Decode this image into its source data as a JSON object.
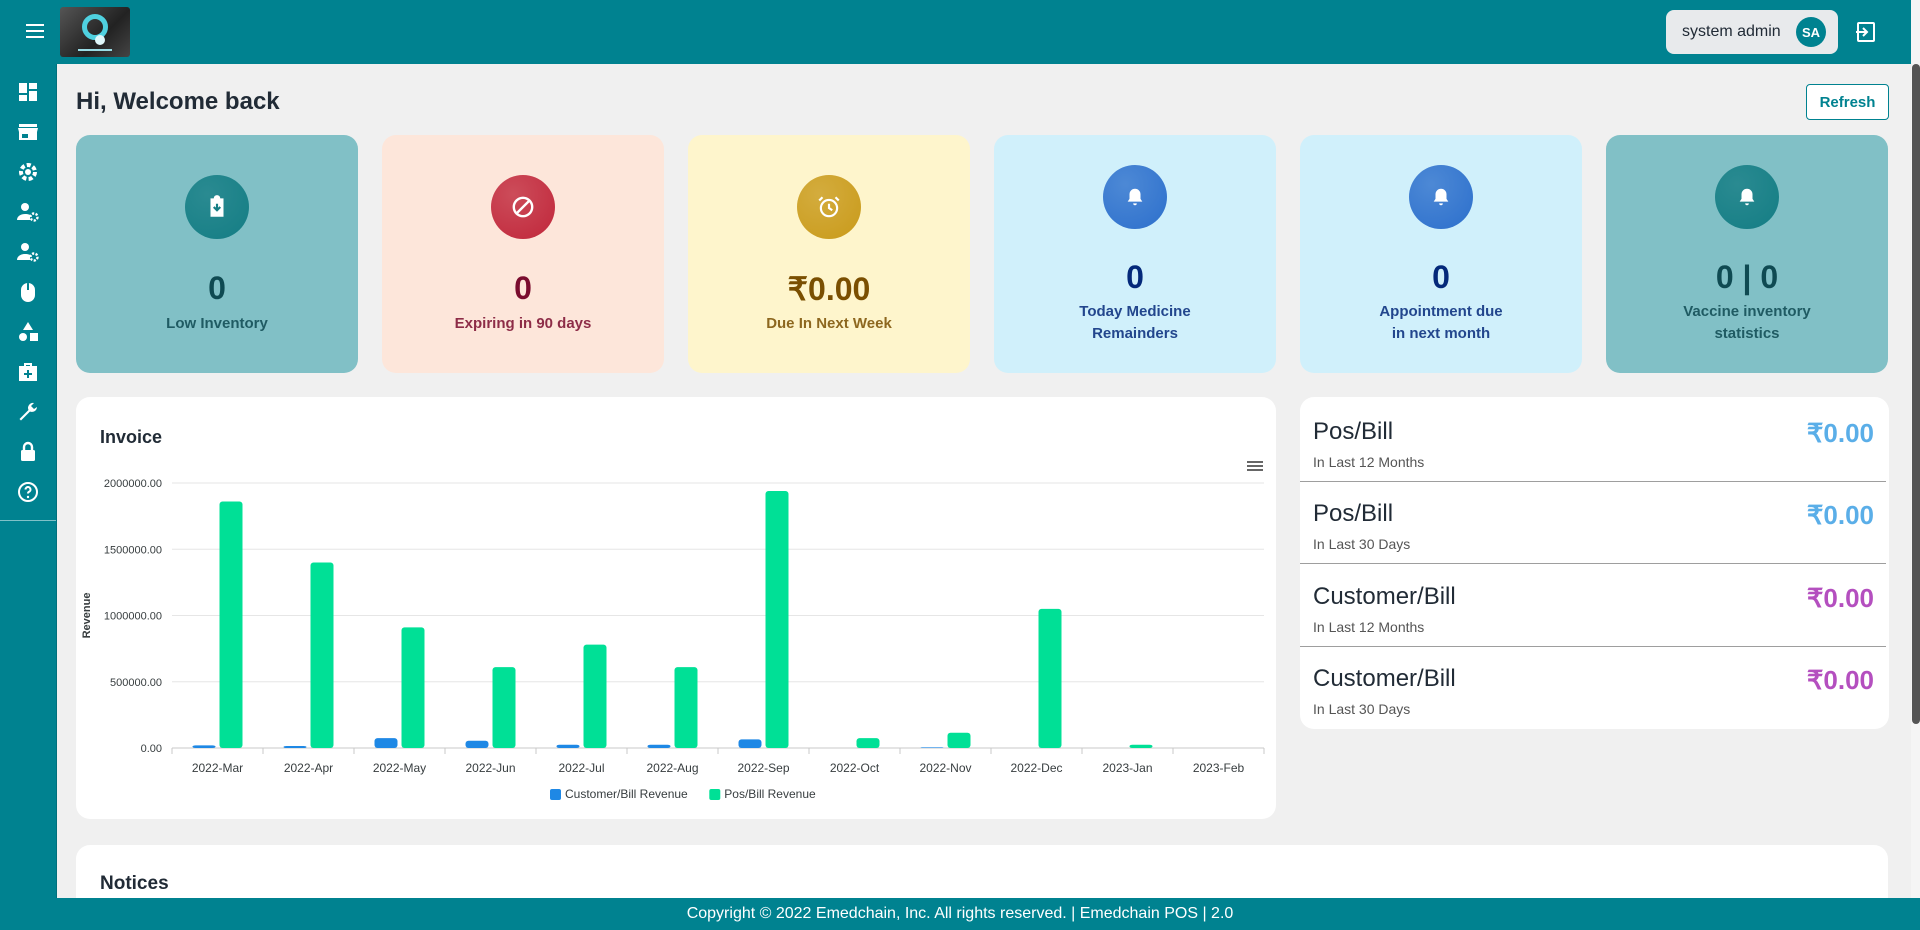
{
  "header": {
    "user_name": "system admin",
    "user_initials": "SA"
  },
  "page": {
    "title": "Hi, Welcome back",
    "refresh_label": "Refresh"
  },
  "cards": [
    {
      "value": "0",
      "label": "Low Inventory",
      "icon": "clipboard-download-icon",
      "bg": "#81c0c6",
      "circle": "#147d84",
      "color": "#0f4a52"
    },
    {
      "value": "0",
      "label": "Expiring in 90 days",
      "icon": "block-icon",
      "bg": "#fde6da",
      "circle": "#c0263a",
      "color": "#7a0c2e"
    },
    {
      "value": "₹0.00",
      "label": "Due In Next Week",
      "icon": "alarm-clock-icon",
      "bg": "#fef5cc",
      "circle": "#c99a1a",
      "color": "#7a4f01"
    },
    {
      "value": "0",
      "label_line1": "Today Medicine",
      "label_line2": "Remainders",
      "icon": "bell-icon",
      "bg": "#d0f0fb",
      "circle": "#2c6fcc",
      "color": "#04297a"
    },
    {
      "value": "0",
      "label_line1": "Appointment due",
      "label_line2": "in next month",
      "icon": "bell-icon",
      "bg": "#d0f0fb",
      "circle": "#2c6fcc",
      "color": "#04297a"
    },
    {
      "value": "0 | 0",
      "label_line1": "Vaccine inventory",
      "label_line2": "statistics",
      "icon": "bell-icon",
      "bg": "#81c0c6",
      "circle": "#147d84",
      "color": "#0f4a52"
    }
  ],
  "chart_data": {
    "type": "bar",
    "title": "Invoice",
    "ylabel": "Revenue",
    "xlabel": "",
    "categories": [
      "2022-Mar",
      "2022-Apr",
      "2022-May",
      "2022-Jun",
      "2022-Jul",
      "2022-Aug",
      "2022-Sep",
      "2022-Oct",
      "2022-Nov",
      "2022-Dec",
      "2023-Jan",
      "2023-Feb"
    ],
    "series": [
      {
        "name": "Customer/Bill Revenue",
        "color": "#1e88e5",
        "values": [
          20000,
          15000,
          75000,
          55000,
          25000,
          25000,
          65000,
          0,
          5000,
          0,
          0,
          0
        ]
      },
      {
        "name": "Pos/Bill Revenue",
        "color": "#00e096",
        "values": [
          1860000,
          1400000,
          910000,
          610000,
          780000,
          610000,
          1940000,
          75000,
          115000,
          1050000,
          25000,
          0
        ]
      }
    ],
    "yticks": [
      "0.00",
      "500000.00",
      "1000000.00",
      "1500000.00",
      "2000000.00"
    ],
    "ylim": [
      0,
      2000000
    ],
    "grid": true,
    "legend": "bottom"
  },
  "stats": [
    {
      "title": "Pos/Bill",
      "sub": "In Last 12 Months",
      "value": "₹0.00",
      "color": "#5aaee8"
    },
    {
      "title": "Pos/Bill",
      "sub": "In Last 30 Days",
      "value": "₹0.00",
      "color": "#5aaee8"
    },
    {
      "title": "Customer/Bill",
      "sub": "In Last 12 Months",
      "value": "₹0.00",
      "color": "#b44fbf"
    },
    {
      "title": "Customer/Bill",
      "sub": "In Last 30 Days",
      "value": "₹0.00",
      "color": "#b44fbf"
    }
  ],
  "notices": {
    "title": "Notices"
  },
  "footer": {
    "text": "Copyright © 2022 Emedchain, Inc. All rights reserved. | Emedchain POS | 2.0"
  },
  "sidebar_icons": [
    "dashboard-icon",
    "store-icon",
    "gear-icon",
    "user-settings-icon",
    "user-settings-icon",
    "mouse-icon",
    "shapes-icon",
    "medical-bag-icon",
    "wrench-icon",
    "lock-icon",
    "help-icon"
  ]
}
